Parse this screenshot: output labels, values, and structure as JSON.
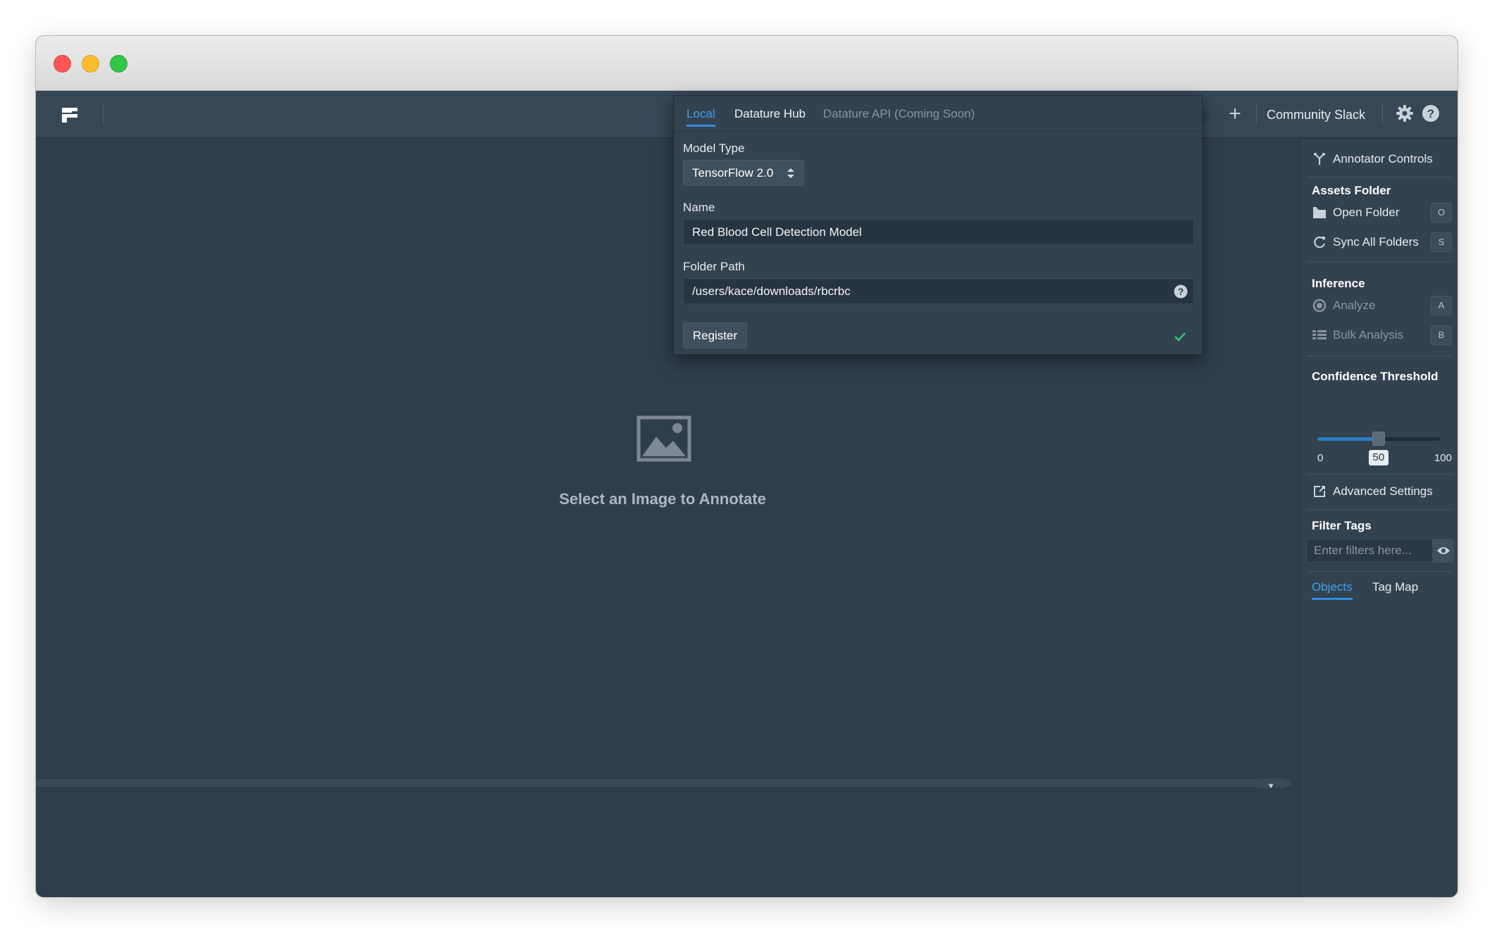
{
  "appbar": {
    "community_label": "Community Slack",
    "plus_label": "+"
  },
  "canvas": {
    "empty_message": "Select an Image to Annotate",
    "collapse_glyph": "▾"
  },
  "popover": {
    "tabs": [
      {
        "label": "Local",
        "state": "active"
      },
      {
        "label": "Datature Hub",
        "state": "normal"
      },
      {
        "label": "Datature API (Coming Soon)",
        "state": "disabled"
      }
    ],
    "model_type_label": "Model Type",
    "model_type_value": "TensorFlow 2.0",
    "name_label": "Name",
    "name_value": "Red Blood Cell Detection Model",
    "folder_path_label": "Folder Path",
    "folder_path_value": "/users/kace/downloads/rbcrbc",
    "register_label": "Register"
  },
  "sidebar": {
    "annotator_controls": "Annotator Controls",
    "assets_folder_heading": "Assets Folder",
    "open_folder": {
      "label": "Open Folder",
      "hotkey": "O"
    },
    "sync_folders": {
      "label": "Sync All Folders",
      "hotkey": "S"
    },
    "inference_heading": "Inference",
    "analyze": {
      "label": "Analyze",
      "hotkey": "A"
    },
    "bulk_analysis": {
      "label": "Bulk Analysis",
      "hotkey": "B"
    },
    "confidence_heading": "Confidence Threshold",
    "confidence": {
      "min": "0",
      "max": "100",
      "value": "50",
      "fraction": 0.5
    },
    "advanced_settings": "Advanced Settings",
    "filter_heading": "Filter Tags",
    "filter_placeholder": "Enter filters here...",
    "tabs": [
      {
        "label": "Objects",
        "state": "active"
      },
      {
        "label": "Tag Map",
        "state": "inactive"
      }
    ]
  },
  "colors": {
    "accent": "#2d8ee0",
    "background": "#2f3e4c",
    "success": "#2ecc71"
  },
  "icons": [
    "app-logo-icon",
    "plus-icon",
    "gear-icon",
    "help-icon",
    "image-placeholder-icon",
    "annotator-controls-icon",
    "folder-icon",
    "sync-icon",
    "analyze-icon",
    "bulk-analysis-icon",
    "advanced-settings-icon",
    "eye-icon",
    "select-arrows-icon",
    "check-icon"
  ]
}
